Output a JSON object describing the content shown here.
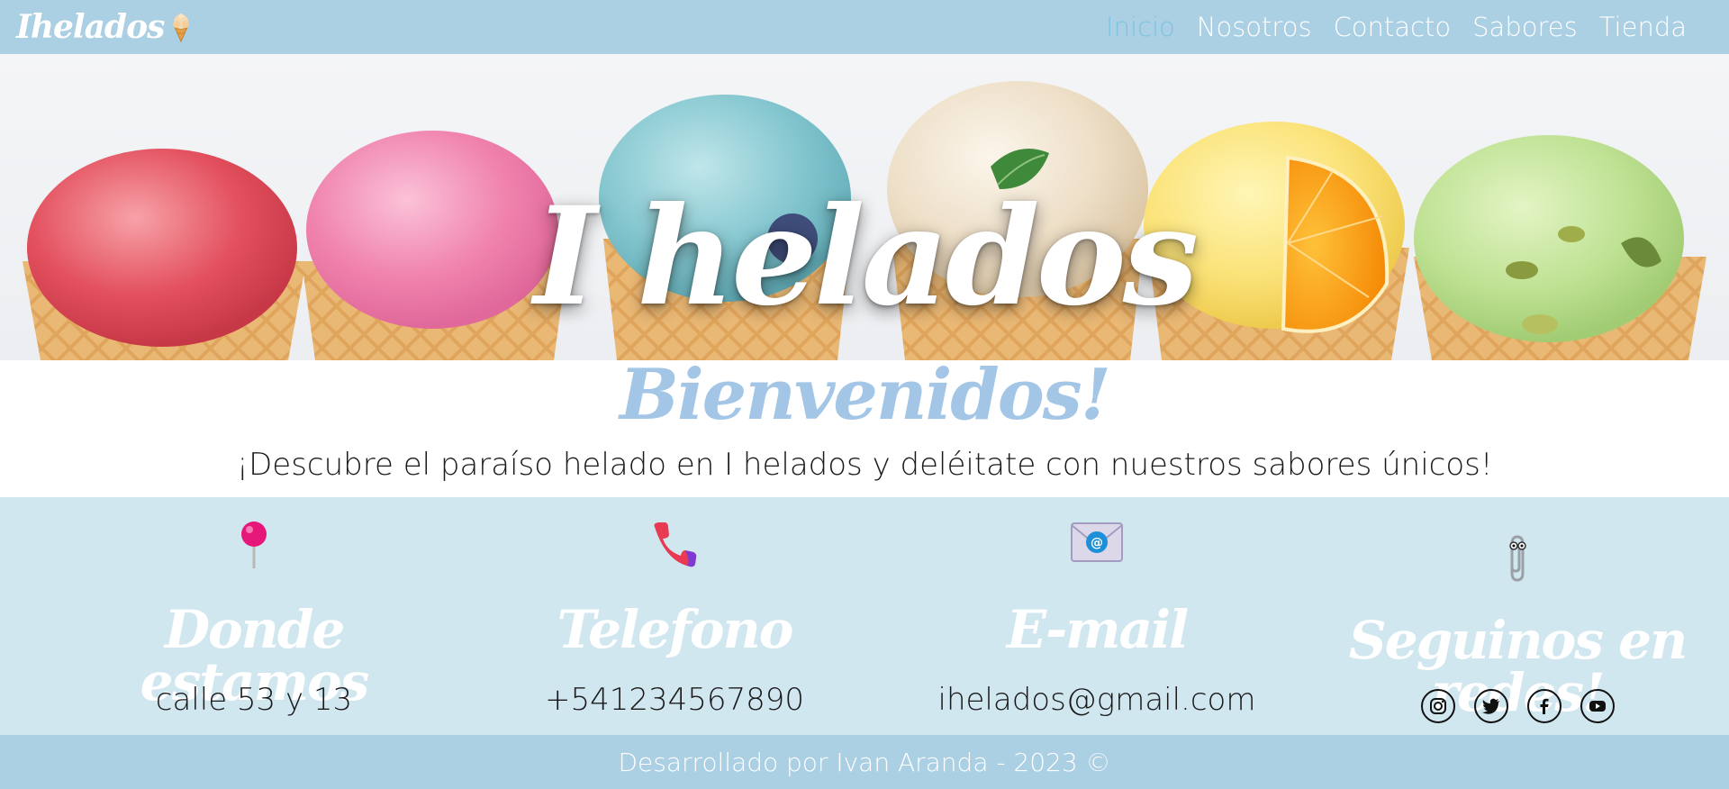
{
  "navbar": {
    "brand": "Ihelados",
    "brand_icon": "ice-cream-icon",
    "links": [
      {
        "label": "Inicio",
        "active": true
      },
      {
        "label": "Nosotros",
        "active": false
      },
      {
        "label": "Contacto",
        "active": false
      },
      {
        "label": "Sabores",
        "active": false
      },
      {
        "label": "Tienda",
        "active": false
      }
    ]
  },
  "hero": {
    "title": "I helados"
  },
  "welcome": {
    "title": "Bienvenidos!",
    "subtitle": "¡Descubre el paraíso helado en I helados y deléitate con nuestros sabores únicos!"
  },
  "contact": {
    "location": {
      "icon": "pushpin-icon",
      "heading": "Donde estamos",
      "value": "calle 53 y 13"
    },
    "phone": {
      "icon": "telephone-icon",
      "heading": "Telefono",
      "value": "+541234567890"
    },
    "email": {
      "icon": "envelope-icon",
      "heading": "E-mail",
      "value": "ihelados@gmail.com"
    },
    "social": {
      "icon": "paperclip-icon",
      "heading": "Seguinos en redes!",
      "networks": [
        "instagram-icon",
        "twitter-icon",
        "facebook-icon",
        "youtube-icon"
      ]
    }
  },
  "footer": {
    "text": "Desarrollado por Ivan Aranda - 2023 ©"
  },
  "colors": {
    "navbar_bg": "#abcfe3",
    "contact_bg": "#d1e7f0",
    "accent_active": "#7fc4e0",
    "welcome_title": "#a4c6e6"
  }
}
